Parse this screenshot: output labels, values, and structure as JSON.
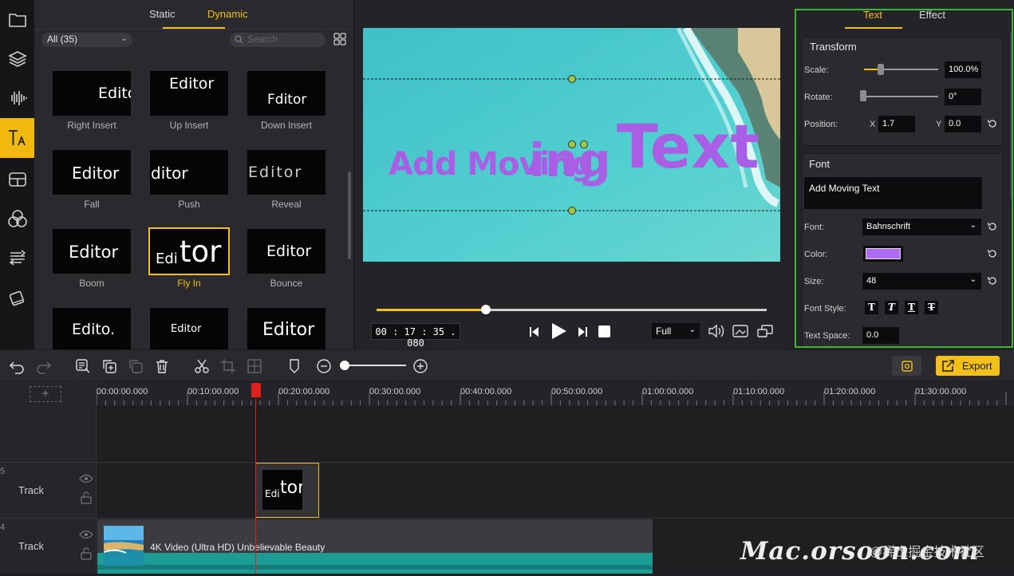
{
  "library": {
    "tabs": [
      "Static",
      "Dynamic"
    ],
    "active_tab": "Dynamic",
    "filter": "All (35)",
    "search_placeholder": "Search",
    "effects": [
      {
        "name": "Right Insert",
        "sample": "Editc"
      },
      {
        "name": "Up Insert",
        "sample": "Editor"
      },
      {
        "name": "Down Insert",
        "sample": "Fditor"
      },
      {
        "name": "Fall",
        "sample": "Editor"
      },
      {
        "name": "Push",
        "sample": "ditor"
      },
      {
        "name": "Reveal",
        "sample": "Editor"
      },
      {
        "name": "Boom",
        "sample": "Editor"
      },
      {
        "name": "Fly In",
        "sample_small": "Edi",
        "sample_big": "tor"
      },
      {
        "name": "Bounce",
        "sample": "Editor"
      },
      {
        "sample": "Edito."
      },
      {
        "sample": "Editor"
      },
      {
        "sample": "Editor"
      }
    ],
    "selected_effect": "Fly In"
  },
  "preview": {
    "overlay_text_small": "Add Moving",
    "overlay_text_big": "Text",
    "timecode": "00 : 17 : 35 . 080",
    "progress": 0.28,
    "zoom_select": "Full",
    "text_color": "#a95ee6"
  },
  "properties": {
    "tabs": [
      "Text",
      "Effect"
    ],
    "active_tab": "Text",
    "transform": {
      "title": "Transform",
      "scale_label": "Scale:",
      "scale_value": "100.0%",
      "rotate_label": "Rotate:",
      "rotate_value": "0°",
      "position_label": "Position:",
      "x_label": "X",
      "x_value": "1.7",
      "y_label": "Y",
      "y_value": "0.0"
    },
    "font": {
      "title": "Font",
      "text_value": "Add Moving Text",
      "font_label": "Font:",
      "font_value": "Bahnschrift",
      "color_label": "Color:",
      "color_value": "#b06cf0",
      "size_label": "Size:",
      "size_value": "48",
      "style_label": "Font Style:",
      "space_label": "Text Space:",
      "space_value": "0.0"
    }
  },
  "toolbar": {
    "export_label": "Export"
  },
  "timeline": {
    "ticks": [
      "00:00:00.000",
      "00:10:00.000",
      "00:20:00.000",
      "00:30:00.000",
      "00:40:00.000",
      "00:50:00.000",
      "01:00:00.000",
      "01:10:00.000",
      "01:20:00.000",
      "01:30:00.000"
    ],
    "tracks": [
      {
        "number": "5",
        "label": "Track"
      },
      {
        "number": "4",
        "label": "Track"
      }
    ],
    "text_clip": {
      "small": "Edi",
      "big": "tor"
    },
    "video_clip_title": "4K Video (Ultra HD) Unbelievable Beauty"
  },
  "watermark": {
    "text": "Mac.orsoon.com",
    "cn": "@稀土掘金技术社区"
  }
}
